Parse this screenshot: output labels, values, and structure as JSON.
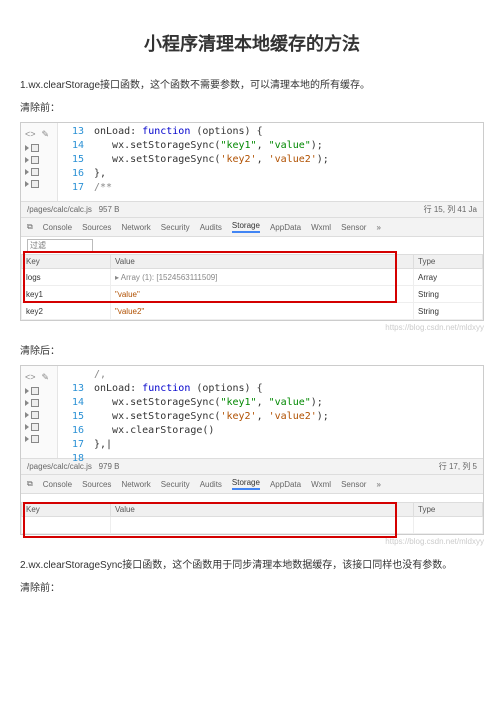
{
  "title": "小程序清理本地缓存的方法",
  "section1": {
    "intro": "1.wx.clearStorage接口函数，这个函数不需要参数，可以清理本地的所有缓存。",
    "before_label": "清除前：",
    "after_label": "清除后："
  },
  "section2": {
    "intro": "2.wx.clearStorageSync接口函数，这个函数用于同步清理本地数据缓存，该接口同样也没有参数。",
    "before_label": "清除前："
  },
  "ide1": {
    "linenos": [
      "13",
      "14",
      "15",
      "16",
      "17"
    ],
    "code": {
      "l1_a": "onLoad: ",
      "l1_b": "function",
      "l1_c": " (options) {",
      "l2_a": "   wx.setStorageSync(",
      "l2_b": "\"key1\"",
      "l2_c": ", ",
      "l2_d": "\"value\"",
      "l2_e": ");",
      "l3_a": "   wx.setStorageSync(",
      "l3_b": "'key2'",
      "l3_c": ", ",
      "l3_d": "'value2'",
      "l3_e": ");",
      "l4": "},",
      "l5": "/**"
    },
    "filebar": {
      "path": "/pages/calc/calc.js",
      "size": "957 B",
      "pos": "行 15, 列 41  Ja"
    },
    "tabs": [
      "Console",
      "Sources",
      "Network",
      "Security",
      "Audits",
      "Storage",
      "AppData",
      "Wxml",
      "Sensor",
      "»"
    ],
    "filter_placeholder": "过滤",
    "headers": {
      "key": "Key",
      "value": "Value",
      "type": "Type"
    },
    "rows": [
      {
        "key": "logs",
        "value": "▸ Array (1): [1524563111509]",
        "type": "Array"
      },
      {
        "key": "key1",
        "value": "\"value\"",
        "type": "String"
      },
      {
        "key": "key2",
        "value": "\"value2\"",
        "type": "String"
      }
    ]
  },
  "ide2": {
    "linenos": [
      "13",
      "14",
      "15",
      "16",
      "17",
      "18"
    ],
    "code": {
      "l0": "/,",
      "l1_a": "onLoad: ",
      "l1_b": "function",
      "l1_c": " (options) {",
      "l2_a": "   wx.setStorageSync(",
      "l2_b": "\"key1\"",
      "l2_c": ", ",
      "l2_d": "\"value\"",
      "l2_e": ");",
      "l3_a": "   wx.setStorageSync(",
      "l3_b": "'key2'",
      "l3_c": ", ",
      "l3_d": "'value2'",
      "l3_e": ");",
      "l4": "   wx.clearStorage()",
      "l5": "},"
    },
    "filebar": {
      "path": "/pages/calc/calc.js",
      "size": "979 B",
      "pos": "行 17, 列 5"
    },
    "tabs": [
      "Console",
      "Sources",
      "Network",
      "Security",
      "Audits",
      "Storage",
      "AppData",
      "Wxml",
      "Sensor",
      "»"
    ],
    "headers": {
      "key": "Key",
      "value": "Value",
      "type": "Type"
    }
  },
  "watermark": "https://blog.csdn.net/mldxyy",
  "icons": {
    "arrows": "<>",
    "pencil": "✎"
  }
}
